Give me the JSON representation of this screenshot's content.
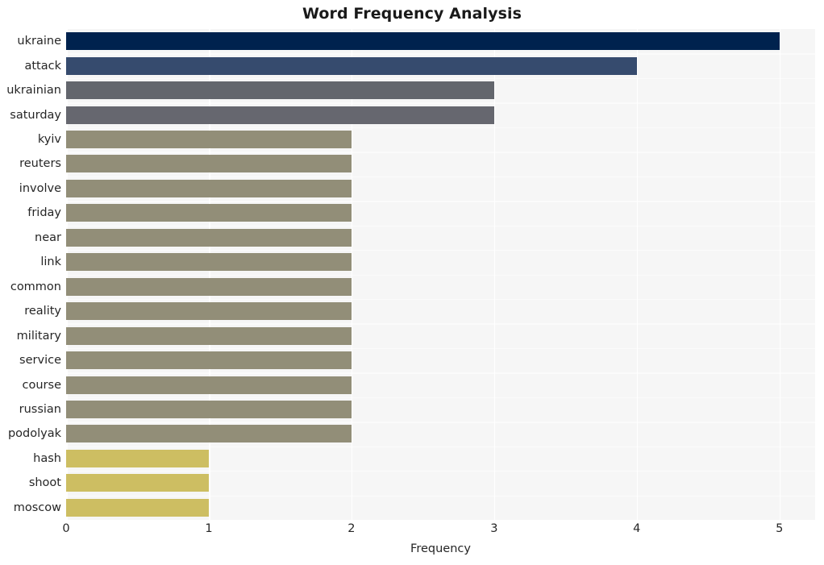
{
  "chart_data": {
    "type": "bar",
    "orientation": "horizontal",
    "title": "Word Frequency Analysis",
    "xlabel": "Frequency",
    "ylabel": "",
    "xlim": [
      0,
      5.25
    ],
    "xticks": [
      "0",
      "1",
      "2",
      "3",
      "4",
      "5"
    ],
    "xtick_values": [
      0,
      1,
      2,
      3,
      4,
      5
    ],
    "grid": "vertical-white-on-light-gray",
    "legend": "none",
    "categories": [
      "ukraine",
      "attack",
      "ukrainian",
      "saturday",
      "kyiv",
      "reuters",
      "involve",
      "friday",
      "near",
      "link",
      "common",
      "reality",
      "military",
      "service",
      "course",
      "russian",
      "podolyak",
      "hash",
      "shoot",
      "moscow"
    ],
    "values": [
      5,
      4,
      3,
      3,
      2,
      2,
      2,
      2,
      2,
      2,
      2,
      2,
      2,
      2,
      2,
      2,
      2,
      1,
      1,
      1
    ],
    "bar_colors": [
      "#00224e",
      "#364b6e",
      "#63666d",
      "#66676f",
      "#928e78",
      "#928e78",
      "#928e78",
      "#928e78",
      "#928e78",
      "#928e78",
      "#928e78",
      "#928e78",
      "#928e78",
      "#928e78",
      "#928e78",
      "#928e78",
      "#928e78",
      "#cdbe62",
      "#cdbe62",
      "#cdbe62"
    ],
    "plot_background": "#f6f6f6",
    "figure_background": "#ffffff",
    "gridline_color": "#ffffff"
  }
}
